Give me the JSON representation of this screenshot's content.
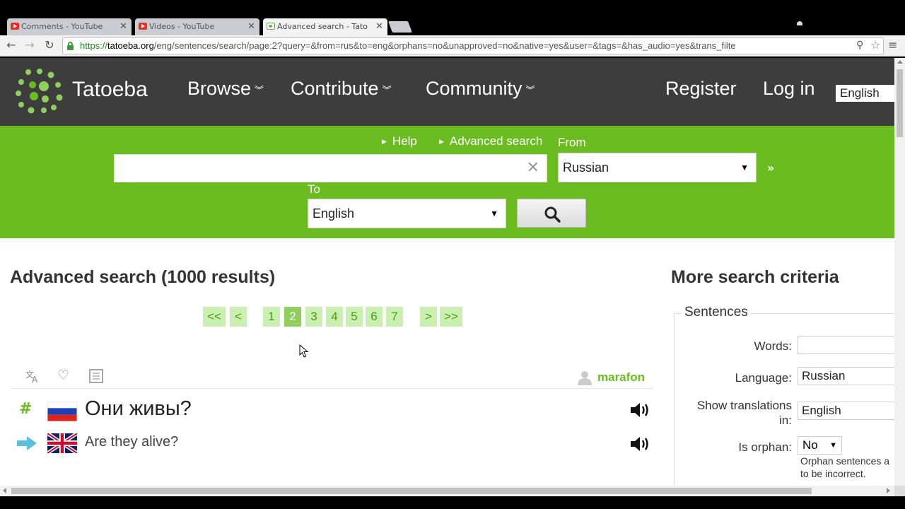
{
  "browser": {
    "tabs": [
      {
        "title": "Comments - YouTube",
        "favicon": "youtube-icon"
      },
      {
        "title": "Videos - YouTube",
        "favicon": "youtube-icon"
      },
      {
        "title": "Advanced search - Tatoeba",
        "favicon": "tatoeba-icon"
      }
    ],
    "url_proto": "https://",
    "url_host": "tatoeba.org",
    "url_rest": "/eng/sentences/search/page:2?query=&from=rus&to=eng&orphans=no&unapproved=no&native=yes&user=&tags=&has_audio=yes&trans_filte"
  },
  "header": {
    "logo": "Tatoeba",
    "nav": [
      "Browse",
      "Contribute",
      "Community"
    ],
    "register": "Register",
    "login": "Log in",
    "interface_lang": "English"
  },
  "search": {
    "help": "Help",
    "advanced": "Advanced search",
    "from_label": "From",
    "to_label": "To",
    "from_value": "Russian",
    "to_value": "English",
    "query_value": "",
    "swap": "»"
  },
  "results": {
    "title": "Advanced search (1000 results)",
    "pager": {
      "first": "<<",
      "prev": "<",
      "pages": [
        "1",
        "2",
        "3",
        "4",
        "5",
        "6",
        "7"
      ],
      "current": "2",
      "next": ">",
      "last": ">>"
    },
    "items": [
      {
        "owner": "marafon",
        "sentence": "Они живы?",
        "sentence_lang": "rus",
        "translation": "Are they alive?",
        "translation_lang": "eng"
      }
    ]
  },
  "sidebar": {
    "title": "More search criteria",
    "legend": "Sentences",
    "words_label": "Words:",
    "words_value": "",
    "language_label": "Language:",
    "language_value": "Russian",
    "show_trans_label_1": "Show translations",
    "show_trans_label_2": "in:",
    "show_trans_value": "English",
    "orphan_label": "Is orphan:",
    "orphan_value": "No",
    "orphan_hint_1": "Orphan sentences a",
    "orphan_hint_2": "to be incorrect."
  },
  "colors": {
    "header_bg": "#3d3d3d",
    "brand_green": "#6bbc20",
    "pager_bg": "#c9efb1",
    "pager_current": "#8fd05d"
  }
}
